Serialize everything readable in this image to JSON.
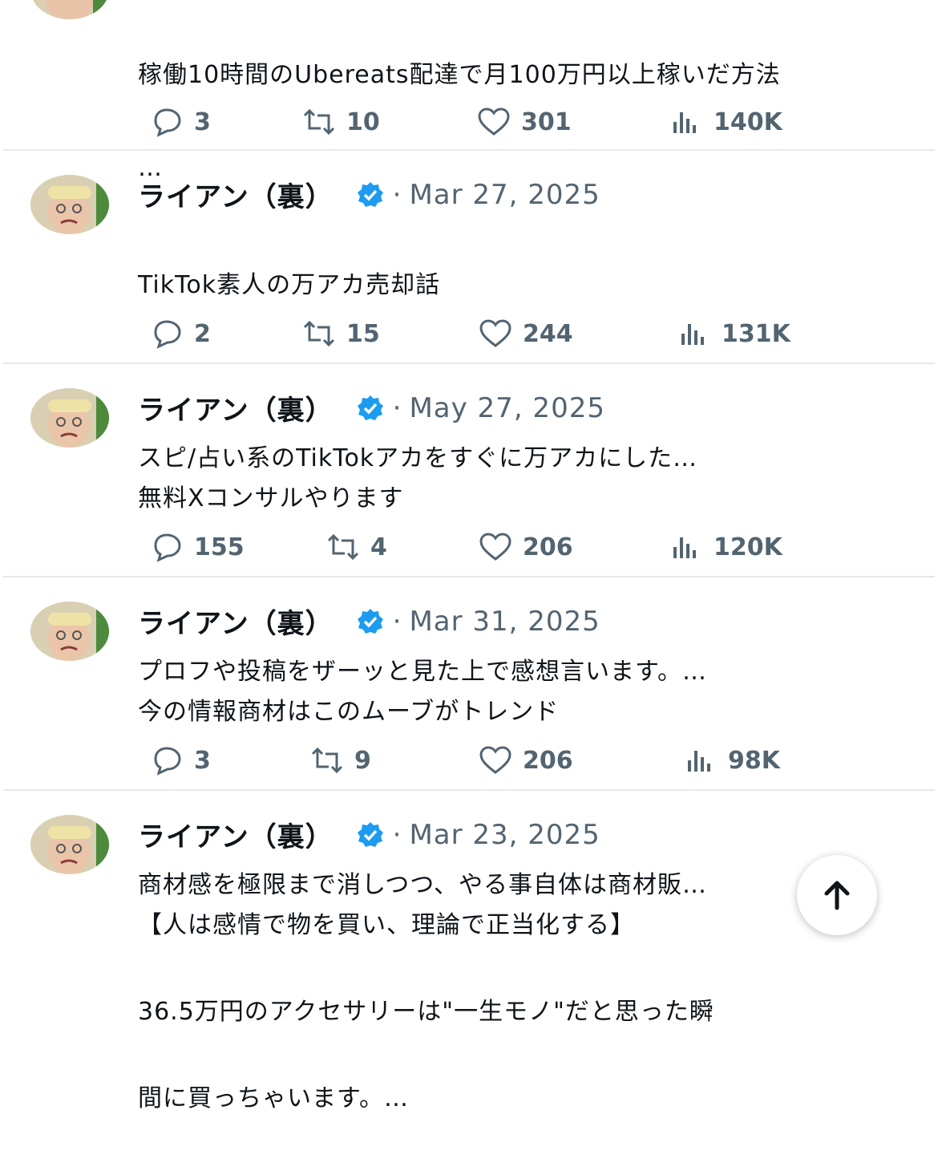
{
  "tweets": [
    {
      "name": "",
      "date": "",
      "lines": [
        "稼働10時間のUbereats配達で月100万円以上稼いだ方法",
        "…"
      ],
      "replies": "3",
      "retweets": "10",
      "likes": "301",
      "views": "140K"
    },
    {
      "name": "ライアン（裏）",
      "date": "Mar 27, 2025",
      "lines": [
        "TikTok素人の万アカ売却話",
        "",
        "スピ/占い系のTikTokアカをすぐに万アカにした…"
      ],
      "replies": "2",
      "retweets": "15",
      "likes": "244",
      "views": "131K"
    },
    {
      "name": "ライアン（裏）",
      "date": "May 27, 2025",
      "lines": [
        "無料Xコンサルやります",
        "",
        "プロフや投稿をザーッと見た上で感想言います。…"
      ],
      "replies": "155",
      "retweets": "4",
      "likes": "206",
      "views": "120K"
    },
    {
      "name": "ライアン（裏）",
      "date": "Mar 31, 2025",
      "lines": [
        "今の情報商材はこのムーブがトレンド",
        "",
        "商材感を極限まで消しつつ、やる事自体は商材販…"
      ],
      "replies": "3",
      "retweets": "9",
      "likes": "206",
      "views": "98K"
    },
    {
      "name": "ライアン（裏）",
      "date": "Mar 23, 2025",
      "lines": [
        "【人は感情で物を買い、理論で正当化する】",
        "36.5万円のアクセサリーは\"一生モノ\"だと思った瞬",
        "間に買っちゃいます。…"
      ],
      "replies": "",
      "retweets": "",
      "likes": "",
      "views": ""
    }
  ],
  "separator": "·",
  "colors": {
    "verified": "#1d9bf0",
    "muted": "#536471",
    "text": "#0f1419"
  },
  "icons": [
    "reply-icon",
    "retweet-icon",
    "like-icon",
    "views-icon",
    "verified-badge-icon",
    "arrow-up-icon"
  ]
}
